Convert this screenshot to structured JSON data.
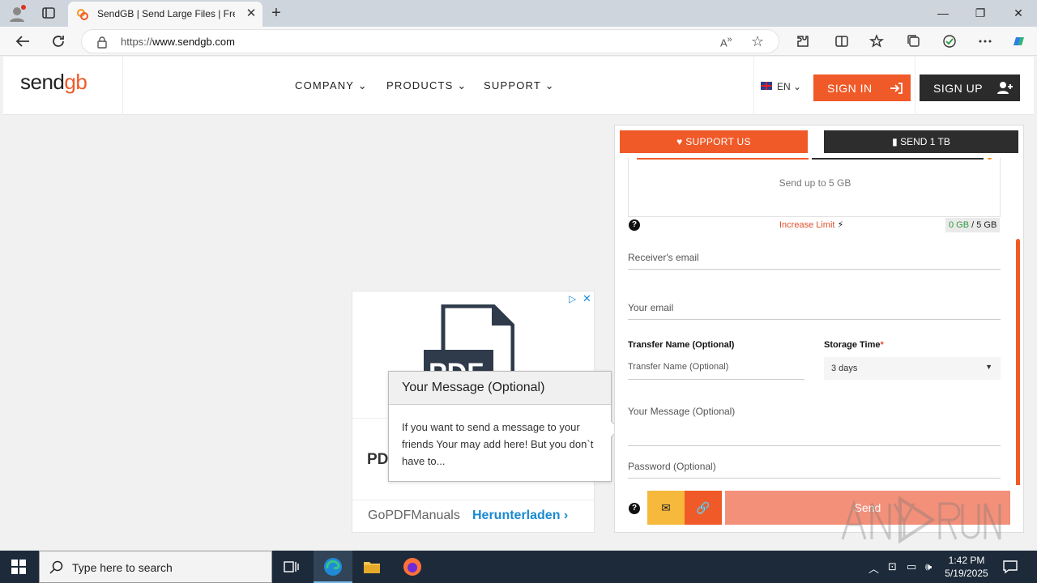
{
  "browser": {
    "tab_title": "SendGB | Send Large Files | Free f",
    "tab_close": "✕",
    "new_tab": "+",
    "url_scheme": "https://",
    "url_host": "www.sendgb.com",
    "window_controls": [
      "—",
      "❐",
      "✕"
    ]
  },
  "site": {
    "logo": {
      "prefix": "send",
      "suffix": "gb"
    },
    "menu": [
      "COMPANY",
      "PRODUCTS",
      "SUPPORT"
    ],
    "lang": "EN",
    "signin": "SIGN IN",
    "signup": "SIGN UP",
    "brand_color": "#f05a28"
  },
  "ad": {
    "title": "PD",
    "brand": "GoPDFManuals",
    "cta": "Herunterladen",
    "pdf_label": "PDF"
  },
  "tooltip": {
    "title": "Your Message (Optional)",
    "body": "If you want to send a message to your friends Your may add here! But you don`t have to..."
  },
  "panel": {
    "support": "SUPPORT US",
    "send1tb": "SEND 1 TB",
    "drop_text": "Send up to 5 GB",
    "increase": "Increase Limit",
    "quota_used": "0 GB",
    "quota_total": "/ 5 GB",
    "receiver_placeholder": "Receiver's email",
    "your_email_placeholder": "Your email",
    "transfer_label": "Transfer Name (Optional)",
    "transfer_placeholder": "Transfer Name (Optional)",
    "storage_label": "Storage Time",
    "storage_required": "*",
    "storage_value": "3 days",
    "message_placeholder": "Your Message  (Optional)",
    "password_placeholder": "Password (Optional)",
    "send": "Send"
  },
  "taskbar": {
    "search_placeholder": "Type here to search",
    "time": "1:42 PM",
    "date": "5/19/2025"
  }
}
